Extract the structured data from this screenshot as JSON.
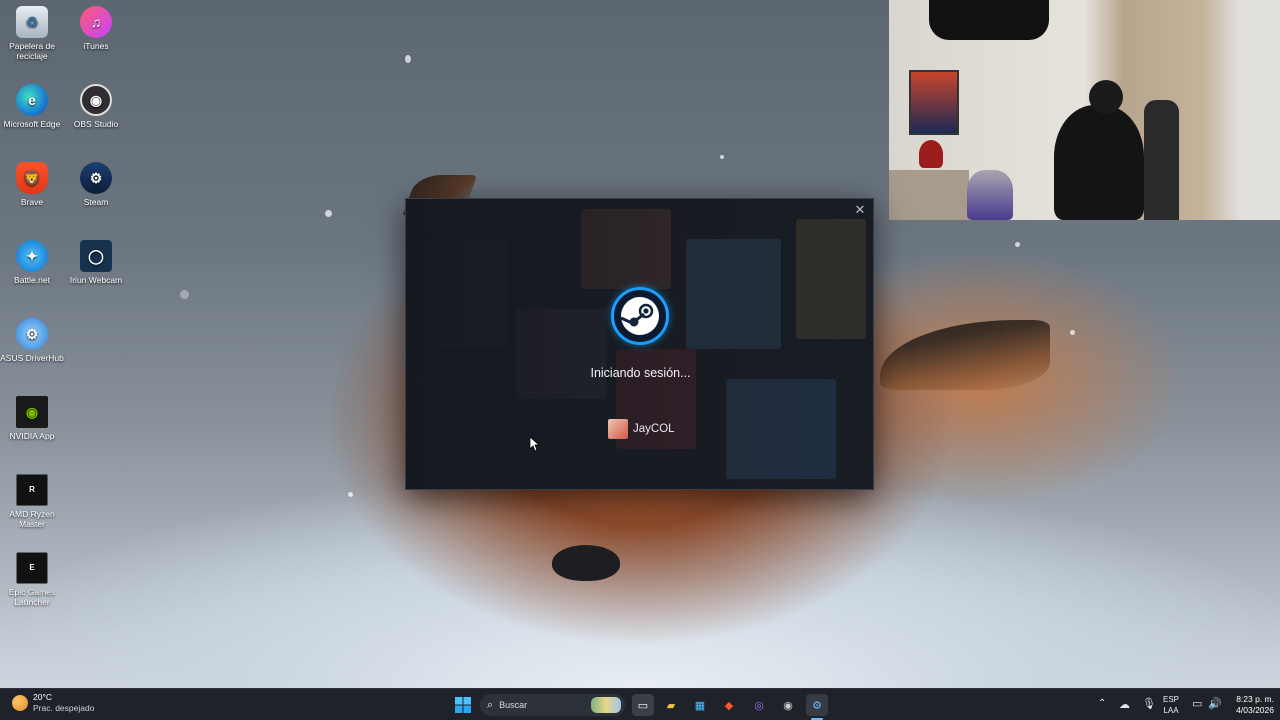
{
  "desktop": {
    "icons": [
      {
        "label": "Papelera de reciclaje",
        "icon": "recycle-bin-icon"
      },
      {
        "label": "iTunes",
        "icon": "itunes-icon"
      },
      {
        "label": "Microsoft Edge",
        "icon": "edge-icon"
      },
      {
        "label": "OBS Studio",
        "icon": "obs-icon"
      },
      {
        "label": "Brave",
        "icon": "brave-icon"
      },
      {
        "label": "Steam",
        "icon": "steam-icon"
      },
      {
        "label": "Battle.net",
        "icon": "battlenet-icon"
      },
      {
        "label": "Iriun Webcam",
        "icon": "iriun-webcam-icon"
      },
      {
        "label": "ASUS DriverHub",
        "icon": "asus-driverhub-icon"
      },
      {
        "label": "NVIDIA App",
        "icon": "nvidia-icon"
      },
      {
        "label": "AMD Ryzen Master",
        "icon": "amd-ryzen-master-icon"
      },
      {
        "label": "Epic Games Launcher",
        "icon": "epic-games-icon"
      }
    ]
  },
  "steam_dialog": {
    "status": "Iniciando sesión...",
    "username": "JayCOL",
    "close_icon": "close-icon",
    "accent": "#1a9fff"
  },
  "taskbar": {
    "weather_temp": "20°C",
    "weather_desc": "Prac. despejado",
    "search_placeholder": "Buscar",
    "language_code": "ESP",
    "language_sub": "LAA",
    "time": "8:23 p. m.",
    "date": "4/03/2026"
  },
  "colors": {
    "taskbar_bg": "#1f2228",
    "dialog_bg": "#1b1f26"
  }
}
